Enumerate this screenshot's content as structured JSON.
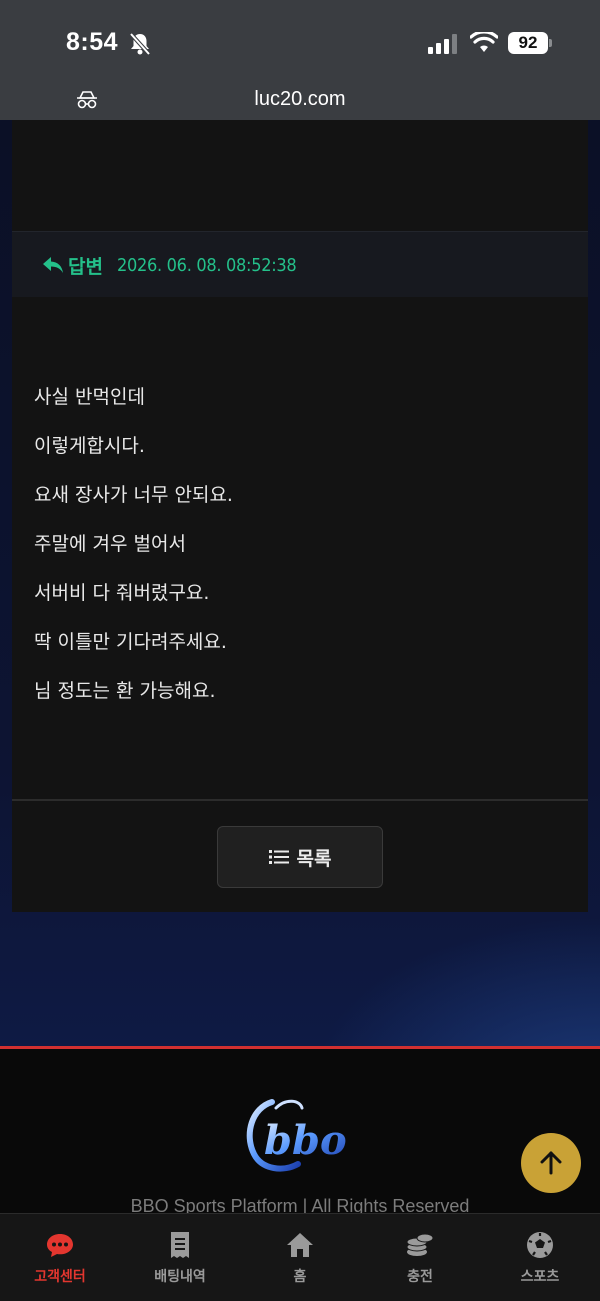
{
  "status_bar": {
    "time": "8:54",
    "battery": "92",
    "url": "luc20.com"
  },
  "reply": {
    "label": "답변",
    "date": "2026. 06. 08. 08:52:38",
    "accent_color": "#24c08a"
  },
  "message": {
    "lines": [
      "사실 반먹인데",
      "이렇게합시다.",
      "요새 장사가 너무 안되요.",
      "주말에 겨우 벌어서",
      "서버비 다 줘버렸구요.",
      "딱 이틀만 기다려주세요.",
      "님 정도는 환 가능해요."
    ]
  },
  "actions": {
    "list_label": "목록"
  },
  "footer": {
    "copyright": "BBO Sports Platform | All Rights Reserved"
  },
  "bottom_nav": {
    "items": [
      {
        "label": "고객센터",
        "icon": "chat-bubble-icon",
        "active": true
      },
      {
        "label": "배팅내역",
        "icon": "receipt-icon",
        "active": false
      },
      {
        "label": "홈",
        "icon": "home-icon",
        "active": false
      },
      {
        "label": "충전",
        "icon": "coins-icon",
        "active": false
      },
      {
        "label": "스포츠",
        "icon": "soccer-ball-icon",
        "active": false
      }
    ],
    "active_color": "#e3362f"
  }
}
